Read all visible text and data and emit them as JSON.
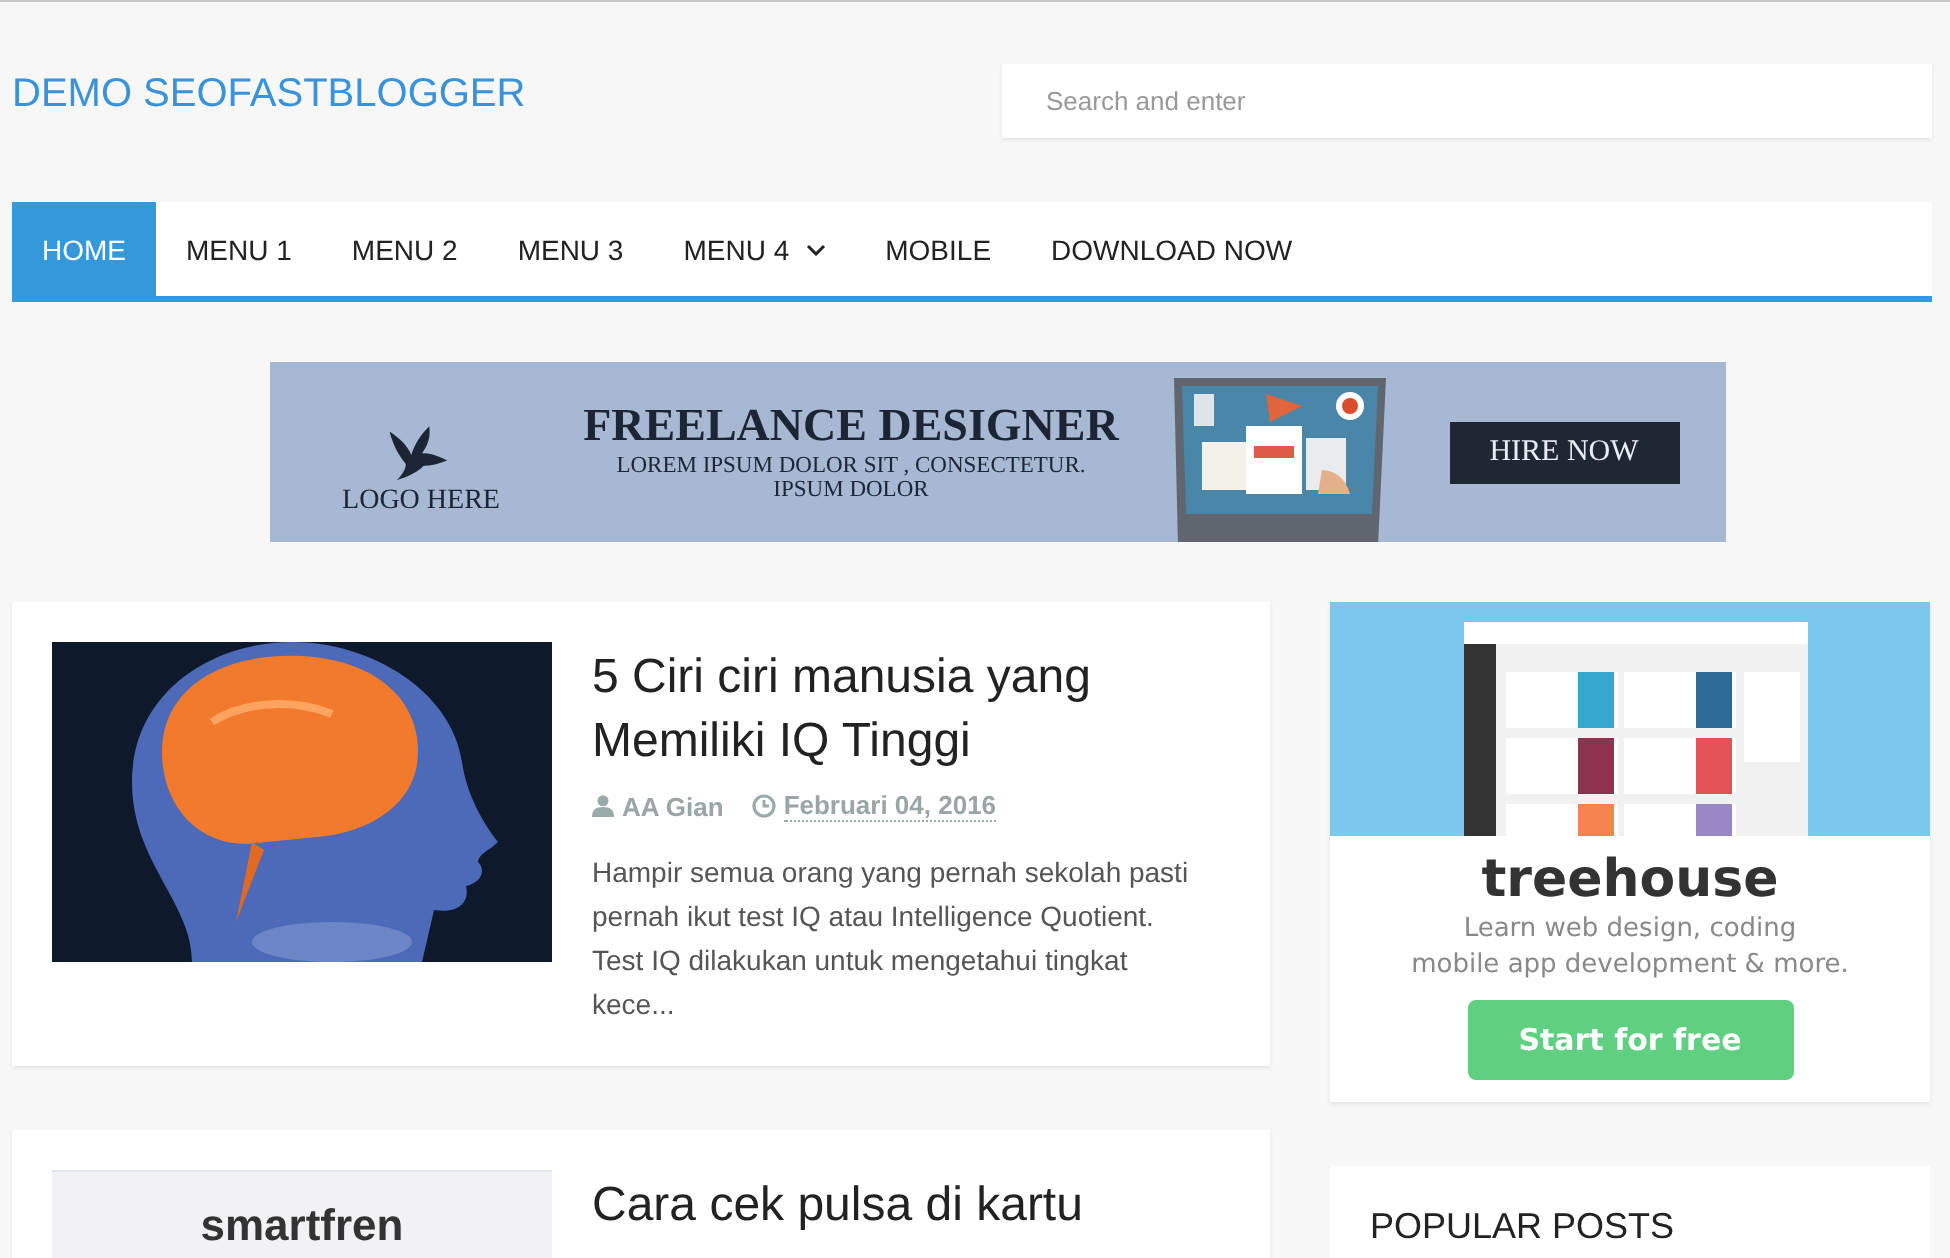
{
  "site_title": "DEMO SEOFASTBLOGGER",
  "search": {
    "placeholder": "Search and enter"
  },
  "nav": [
    {
      "label": "HOME",
      "selected": true,
      "dropdown": false
    },
    {
      "label": "MENU 1",
      "selected": false,
      "dropdown": false
    },
    {
      "label": "MENU 2",
      "selected": false,
      "dropdown": false
    },
    {
      "label": "MENU 3",
      "selected": false,
      "dropdown": false
    },
    {
      "label": "MENU 4",
      "selected": false,
      "dropdown": true
    },
    {
      "label": "MOBILE",
      "selected": false,
      "dropdown": false
    },
    {
      "label": "DOWNLOAD NOW",
      "selected": false,
      "dropdown": false
    }
  ],
  "banner": {
    "logo_text": "LOGO HERE",
    "headline": "FREELANCE DESIGNER",
    "sublines": [
      "LOREM IPSUM DOLOR SIT , CONSECTETUR.",
      "IPSUM DOLOR"
    ],
    "button": "HIRE NOW"
  },
  "posts": [
    {
      "title": "5 Ciri ciri manusia yang Memiliki IQ Tinggi",
      "author": "AA Gian",
      "date": "Februari 04, 2016",
      "excerpt": "Hampir semua orang yang pernah sekolah pasti pernah ikut test IQ atau Intelligence Quotient. Test IQ dilakukan untuk mengetahui tingkat kece..."
    },
    {
      "thumbnail": {
        "kind": "logo",
        "text": "smartfren"
      },
      "title": "Cara cek pulsa di kartu"
    }
  ],
  "sidebar": {
    "ad": {
      "brand": "treehouse",
      "tagline": [
        "Learn web design, coding",
        "mobile app development & more."
      ],
      "button": "Start for free"
    },
    "widget_title": "POPULAR POSTS"
  }
}
